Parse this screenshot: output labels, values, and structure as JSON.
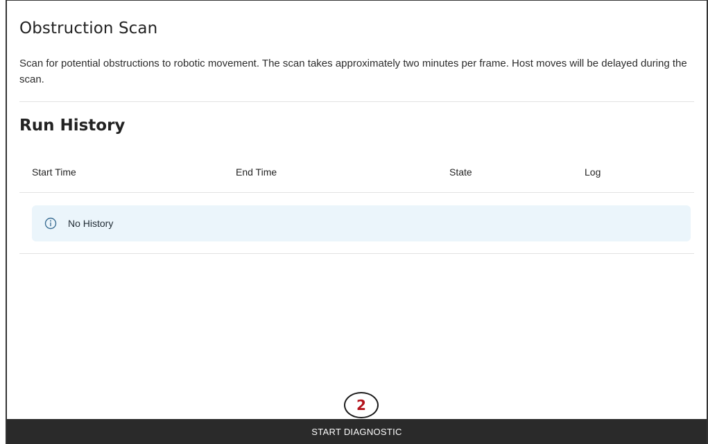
{
  "header": {
    "title": "Obstruction Scan",
    "description": "Scan for potential obstructions to robotic movement. The scan takes approximately two minutes per frame. Host moves will be delayed during the scan."
  },
  "history": {
    "title": "Run History",
    "columns": [
      "Start Time",
      "End Time",
      "State",
      "Log"
    ],
    "empty_message": "No History",
    "empty_icon": "info-icon"
  },
  "footer": {
    "button_label": "START DIAGNOSTIC"
  },
  "annotation": {
    "step": "2",
    "color": "#b3121b"
  },
  "colors": {
    "info_background": "#ebf5fb",
    "footer_background": "#2a2a2a"
  }
}
